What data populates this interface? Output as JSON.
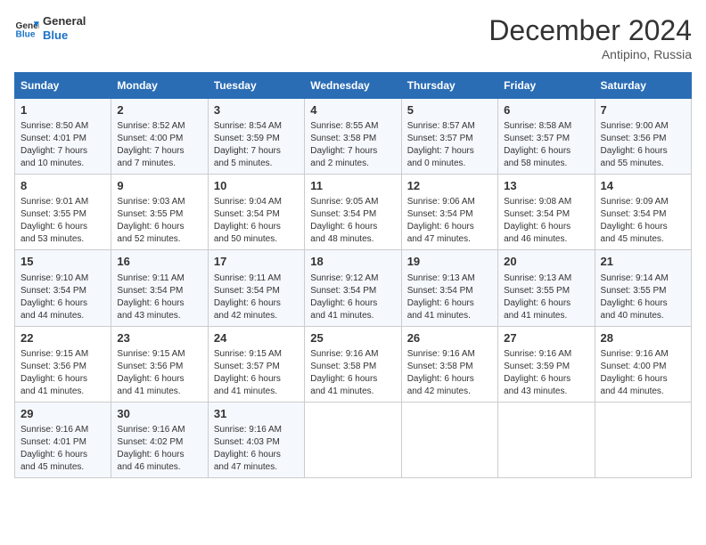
{
  "header": {
    "logo_line1": "General",
    "logo_line2": "Blue",
    "month": "December 2024",
    "location": "Antipino, Russia"
  },
  "weekdays": [
    "Sunday",
    "Monday",
    "Tuesday",
    "Wednesday",
    "Thursday",
    "Friday",
    "Saturday"
  ],
  "weeks": [
    [
      {
        "day": "1",
        "detail": "Sunrise: 8:50 AM\nSunset: 4:01 PM\nDaylight: 7 hours\nand 10 minutes."
      },
      {
        "day": "2",
        "detail": "Sunrise: 8:52 AM\nSunset: 4:00 PM\nDaylight: 7 hours\nand 7 minutes."
      },
      {
        "day": "3",
        "detail": "Sunrise: 8:54 AM\nSunset: 3:59 PM\nDaylight: 7 hours\nand 5 minutes."
      },
      {
        "day": "4",
        "detail": "Sunrise: 8:55 AM\nSunset: 3:58 PM\nDaylight: 7 hours\nand 2 minutes."
      },
      {
        "day": "5",
        "detail": "Sunrise: 8:57 AM\nSunset: 3:57 PM\nDaylight: 7 hours\nand 0 minutes."
      },
      {
        "day": "6",
        "detail": "Sunrise: 8:58 AM\nSunset: 3:57 PM\nDaylight: 6 hours\nand 58 minutes."
      },
      {
        "day": "7",
        "detail": "Sunrise: 9:00 AM\nSunset: 3:56 PM\nDaylight: 6 hours\nand 55 minutes."
      }
    ],
    [
      {
        "day": "8",
        "detail": "Sunrise: 9:01 AM\nSunset: 3:55 PM\nDaylight: 6 hours\nand 53 minutes."
      },
      {
        "day": "9",
        "detail": "Sunrise: 9:03 AM\nSunset: 3:55 PM\nDaylight: 6 hours\nand 52 minutes."
      },
      {
        "day": "10",
        "detail": "Sunrise: 9:04 AM\nSunset: 3:54 PM\nDaylight: 6 hours\nand 50 minutes."
      },
      {
        "day": "11",
        "detail": "Sunrise: 9:05 AM\nSunset: 3:54 PM\nDaylight: 6 hours\nand 48 minutes."
      },
      {
        "day": "12",
        "detail": "Sunrise: 9:06 AM\nSunset: 3:54 PM\nDaylight: 6 hours\nand 47 minutes."
      },
      {
        "day": "13",
        "detail": "Sunrise: 9:08 AM\nSunset: 3:54 PM\nDaylight: 6 hours\nand 46 minutes."
      },
      {
        "day": "14",
        "detail": "Sunrise: 9:09 AM\nSunset: 3:54 PM\nDaylight: 6 hours\nand 45 minutes."
      }
    ],
    [
      {
        "day": "15",
        "detail": "Sunrise: 9:10 AM\nSunset: 3:54 PM\nDaylight: 6 hours\nand 44 minutes."
      },
      {
        "day": "16",
        "detail": "Sunrise: 9:11 AM\nSunset: 3:54 PM\nDaylight: 6 hours\nand 43 minutes."
      },
      {
        "day": "17",
        "detail": "Sunrise: 9:11 AM\nSunset: 3:54 PM\nDaylight: 6 hours\nand 42 minutes."
      },
      {
        "day": "18",
        "detail": "Sunrise: 9:12 AM\nSunset: 3:54 PM\nDaylight: 6 hours\nand 41 minutes."
      },
      {
        "day": "19",
        "detail": "Sunrise: 9:13 AM\nSunset: 3:54 PM\nDaylight: 6 hours\nand 41 minutes."
      },
      {
        "day": "20",
        "detail": "Sunrise: 9:13 AM\nSunset: 3:55 PM\nDaylight: 6 hours\nand 41 minutes."
      },
      {
        "day": "21",
        "detail": "Sunrise: 9:14 AM\nSunset: 3:55 PM\nDaylight: 6 hours\nand 40 minutes."
      }
    ],
    [
      {
        "day": "22",
        "detail": "Sunrise: 9:15 AM\nSunset: 3:56 PM\nDaylight: 6 hours\nand 41 minutes."
      },
      {
        "day": "23",
        "detail": "Sunrise: 9:15 AM\nSunset: 3:56 PM\nDaylight: 6 hours\nand 41 minutes."
      },
      {
        "day": "24",
        "detail": "Sunrise: 9:15 AM\nSunset: 3:57 PM\nDaylight: 6 hours\nand 41 minutes."
      },
      {
        "day": "25",
        "detail": "Sunrise: 9:16 AM\nSunset: 3:58 PM\nDaylight: 6 hours\nand 41 minutes."
      },
      {
        "day": "26",
        "detail": "Sunrise: 9:16 AM\nSunset: 3:58 PM\nDaylight: 6 hours\nand 42 minutes."
      },
      {
        "day": "27",
        "detail": "Sunrise: 9:16 AM\nSunset: 3:59 PM\nDaylight: 6 hours\nand 43 minutes."
      },
      {
        "day": "28",
        "detail": "Sunrise: 9:16 AM\nSunset: 4:00 PM\nDaylight: 6 hours\nand 44 minutes."
      }
    ],
    [
      {
        "day": "29",
        "detail": "Sunrise: 9:16 AM\nSunset: 4:01 PM\nDaylight: 6 hours\nand 45 minutes."
      },
      {
        "day": "30",
        "detail": "Sunrise: 9:16 AM\nSunset: 4:02 PM\nDaylight: 6 hours\nand 46 minutes."
      },
      {
        "day": "31",
        "detail": "Sunrise: 9:16 AM\nSunset: 4:03 PM\nDaylight: 6 hours\nand 47 minutes."
      },
      null,
      null,
      null,
      null
    ]
  ]
}
